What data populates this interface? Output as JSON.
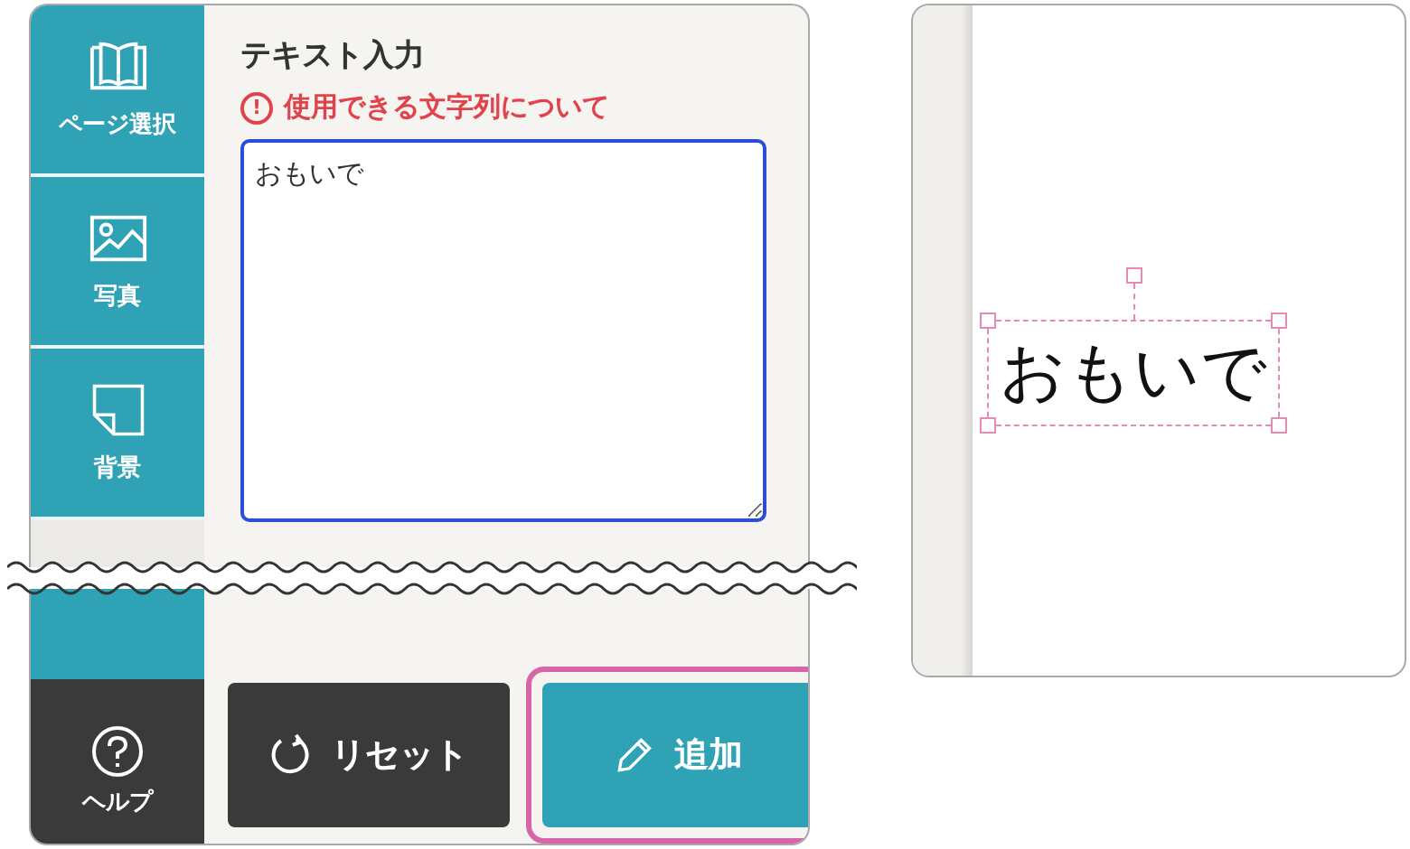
{
  "sidebar": {
    "items": [
      {
        "label": "ページ選択"
      },
      {
        "label": "写真"
      },
      {
        "label": "背景"
      }
    ],
    "help": {
      "label": "ヘルプ"
    }
  },
  "panel": {
    "title": "テキスト入力",
    "notice": "使用できる文字列について",
    "notice_icon": "!",
    "text_value": "おもいで"
  },
  "buttons": [
    {
      "label": "リセット",
      "kind": "reset",
      "highlighted": false
    },
    {
      "label": "追加",
      "kind": "add",
      "highlighted": true
    }
  ],
  "preview": {
    "text": "おもいで",
    "selected": true
  }
}
